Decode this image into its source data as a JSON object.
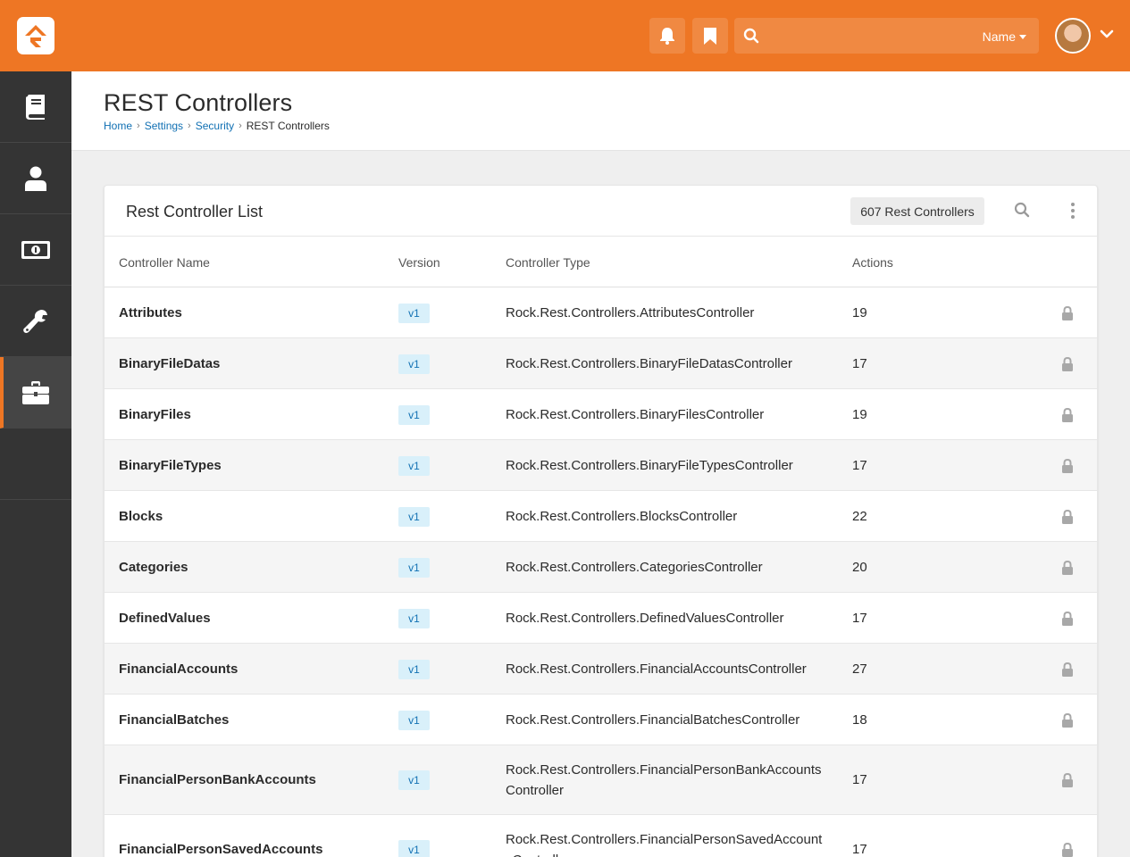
{
  "topbar": {
    "search_filter_label": "Name",
    "icons": [
      "logo-icon",
      "bell-icon",
      "bookmark-icon",
      "search-icon",
      "avatar",
      "chevron-down-icon"
    ],
    "accent_color": "#ee7624"
  },
  "sidebar": {
    "items": [
      {
        "icon": "book-icon"
      },
      {
        "icon": "person-icon"
      },
      {
        "icon": "money-icon"
      },
      {
        "icon": "wrench-icon"
      },
      {
        "icon": "briefcase-icon",
        "active": true
      }
    ]
  },
  "page": {
    "title": "REST Controllers",
    "breadcrumb": [
      "Home",
      "Settings",
      "Security"
    ],
    "breadcrumb_current": "REST Controllers"
  },
  "panel": {
    "title": "Rest Controller List",
    "count_badge": "607 Rest Controllers",
    "columns": [
      "Controller Name",
      "Version",
      "Controller Type",
      "Actions"
    ]
  },
  "rows": [
    {
      "name": "Attributes",
      "version": "v1",
      "type": "Rock.Rest.Controllers.AttributesController",
      "actions": "19"
    },
    {
      "name": "BinaryFileDatas",
      "version": "v1",
      "type": "Rock.Rest.Controllers.BinaryFileDatasController",
      "actions": "17"
    },
    {
      "name": "BinaryFiles",
      "version": "v1",
      "type": "Rock.Rest.Controllers.BinaryFilesController",
      "actions": "19"
    },
    {
      "name": "BinaryFileTypes",
      "version": "v1",
      "type": "Rock.Rest.Controllers.BinaryFileTypesController",
      "actions": "17"
    },
    {
      "name": "Blocks",
      "version": "v1",
      "type": "Rock.Rest.Controllers.BlocksController",
      "actions": "22"
    },
    {
      "name": "Categories",
      "version": "v1",
      "type": "Rock.Rest.Controllers.CategoriesController",
      "actions": "20"
    },
    {
      "name": "DefinedValues",
      "version": "v1",
      "type": "Rock.Rest.Controllers.DefinedValuesController",
      "actions": "17"
    },
    {
      "name": "FinancialAccounts",
      "version": "v1",
      "type": "Rock.Rest.Controllers.FinancialAccountsController",
      "actions": "27"
    },
    {
      "name": "FinancialBatches",
      "version": "v1",
      "type": "Rock.Rest.Controllers.FinancialBatchesController",
      "actions": "18"
    },
    {
      "name": "FinancialPersonBankAccounts",
      "version": "v1",
      "type": "Rock.Rest.Controllers.FinancialPersonBankAccountsController",
      "actions": "17"
    },
    {
      "name": "FinancialPersonSavedAccounts",
      "version": "v1",
      "type": "Rock.Rest.Controllers.FinancialPersonSavedAccountsController",
      "actions": "17"
    }
  ]
}
